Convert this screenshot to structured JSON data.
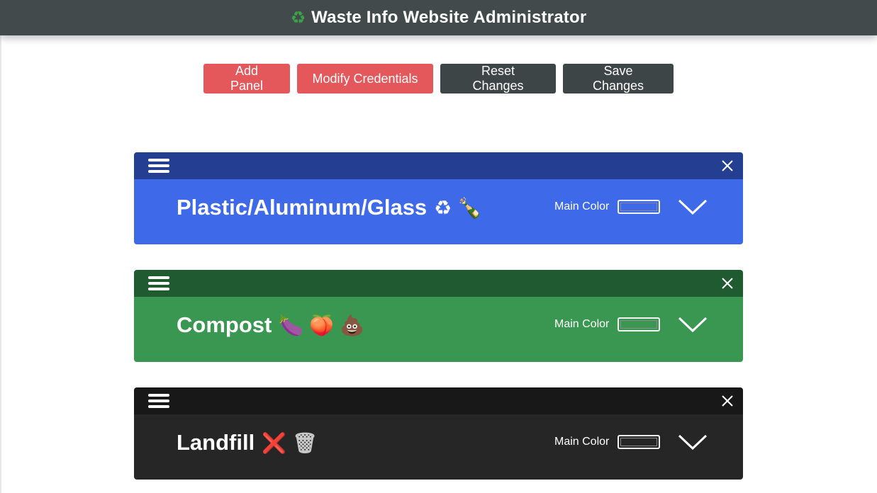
{
  "header": {
    "logo_glyph": "♻",
    "title": "Waste Info Website Administrator"
  },
  "toolbar": {
    "add_panel": "Add Panel",
    "modify_credentials": "Modify Credentials",
    "reset_changes": "Reset Changes",
    "save_changes": "Save Changes"
  },
  "colors": {
    "header_bg": "#424a4b",
    "button_red": "#e4575b",
    "button_dark": "#3d4546"
  },
  "panels": [
    {
      "title": "Plastic/Aluminum/Glass",
      "emojis": [
        "♻",
        "🍾"
      ],
      "emoji_names": [
        "recycle-icon",
        "champagne-bottle-icon"
      ],
      "color_label": "Main Color",
      "header_color": "#243f91",
      "main_color": "#3e69e8"
    },
    {
      "title": "Compost",
      "emojis": [
        "🍆",
        "🍑",
        "💩"
      ],
      "emoji_names": [
        "eggplant-icon",
        "peach-icon",
        "poop-icon"
      ],
      "color_label": "Main Color",
      "header_color": "#1f5a30",
      "main_color": "#3a9751"
    },
    {
      "title": "Landfill",
      "emojis": [
        "❌",
        "🗑"
      ],
      "emoji_names": [
        "cross-mark-icon",
        "wastebasket-icon"
      ],
      "color_label": "Main Color",
      "header_color": "#181818",
      "main_color": "#262626"
    }
  ]
}
